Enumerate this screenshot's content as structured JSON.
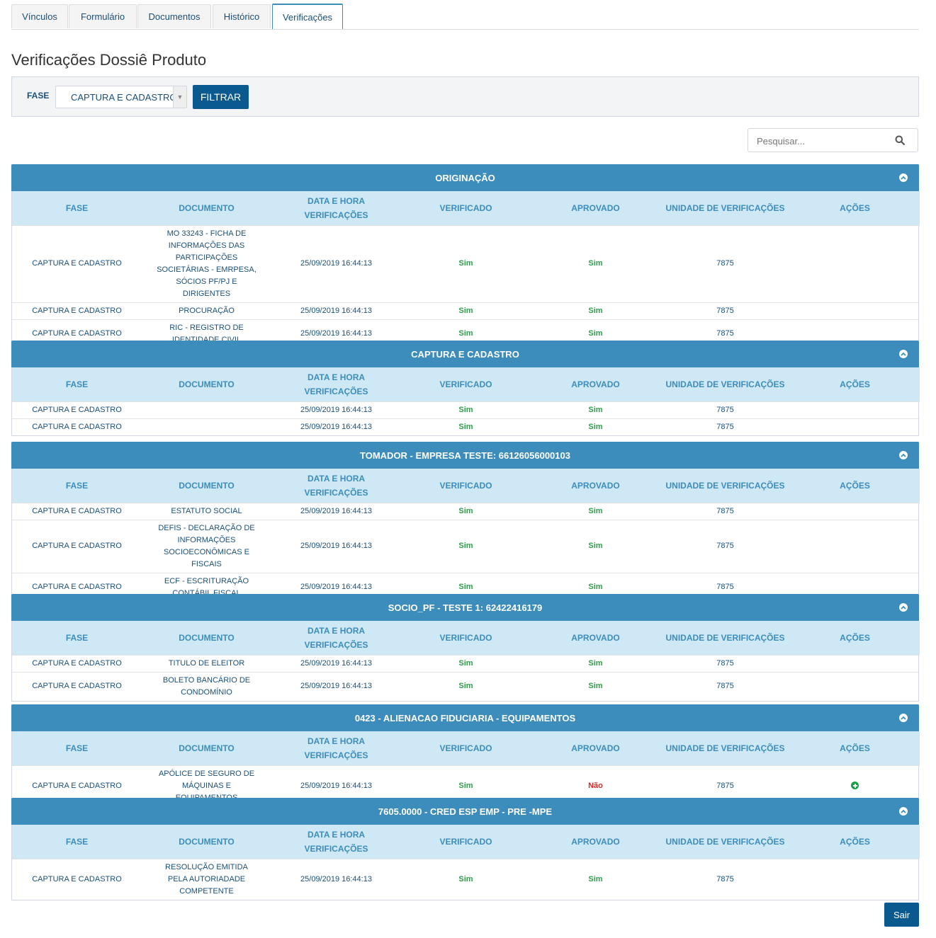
{
  "tabs": [
    {
      "label": "Vínculos"
    },
    {
      "label": "Formulário"
    },
    {
      "label": "Documentos"
    },
    {
      "label": "Histórico"
    },
    {
      "label": "Verificações",
      "active": true
    }
  ],
  "page_title": "Verificações Dossiê Produto",
  "filter": {
    "label": "FASE",
    "selected": "CAPTURA E CADASTRO",
    "button_label": "FILTRAR"
  },
  "search": {
    "placeholder": "Pesquisar..."
  },
  "columns": {
    "fase": "FASE",
    "documento": "DOCUMENTO",
    "data_line1": "DATA E HORA",
    "data_line2": "VERIFICAÇÕES",
    "verificado": "VERIFICADO",
    "aprovado": "APROVADO",
    "unidade": "UNIDADE DE VERIFICAÇÕES",
    "acoes": "AÇÕES"
  },
  "colors": {
    "header_blue": "#3c8dbc",
    "subheader_blue": "#cfe8f5",
    "button_blue": "#0a5a8f",
    "yes_green": "#2e9e4b",
    "no_red": "#dd2222"
  },
  "sections": [
    {
      "title": "ORIGINAÇÃO",
      "rows": [
        {
          "fase": "CAPTURA E CADASTRO",
          "documento": "MO 33243 - FICHA DE INFORMAÇÕES DAS PARTICIPAÇÕES SOCIETÁRIAS - EMRPESA, SÓCIOS PF/PJ E DIRIGENTES",
          "data": "25/09/2019 16:44:13",
          "verificado": "Sim",
          "aprovado": "Sim",
          "unidade": "7875",
          "acao": ""
        },
        {
          "fase": "CAPTURA E CADASTRO",
          "documento": "PROCURAÇÃO",
          "data": "25/09/2019 16:44:13",
          "verificado": "Sim",
          "aprovado": "Sim",
          "unidade": "7875",
          "acao": ""
        },
        {
          "fase": "CAPTURA E CADASTRO",
          "documento": "RIC - REGISTRO DE IDENTIDADE CIVIL",
          "data": "25/09/2019 16:44:13",
          "verificado": "Sim",
          "aprovado": "Sim",
          "unidade": "7875",
          "acao": ""
        }
      ]
    },
    {
      "title": "CAPTURA E CADASTRO",
      "rows": [
        {
          "fase": "CAPTURA E CADASTRO",
          "documento": "",
          "data": "25/09/2019 16:44:13",
          "verificado": "Sim",
          "aprovado": "Sim",
          "unidade": "7875",
          "acao": ""
        },
        {
          "fase": "CAPTURA E CADASTRO",
          "documento": "",
          "data": "25/09/2019 16:44:13",
          "verificado": "Sim",
          "aprovado": "Sim",
          "unidade": "7875",
          "acao": ""
        }
      ]
    },
    {
      "title": "TOMADOR - EMPRESA TESTE: 66126056000103",
      "rows": [
        {
          "fase": "CAPTURA E CADASTRO",
          "documento": "ESTATUTO SOCIAL",
          "data": "25/09/2019 16:44:13",
          "verificado": "Sim",
          "aprovado": "Sim",
          "unidade": "7875",
          "acao": ""
        },
        {
          "fase": "CAPTURA E CADASTRO",
          "documento": "DEFIS - DECLARAÇÃO DE INFORMAÇÕES SOCIOECONÔMICAS E FISCAIS",
          "data": "25/09/2019 16:44:13",
          "verificado": "Sim",
          "aprovado": "Sim",
          "unidade": "7875",
          "acao": ""
        },
        {
          "fase": "CAPTURA E CADASTRO",
          "documento": "ECF - ESCRITURAÇÃO CONTÁBIL FISCAL",
          "data": "25/09/2019 16:44:13",
          "verificado": "Sim",
          "aprovado": "Sim",
          "unidade": "7875",
          "acao": ""
        }
      ]
    },
    {
      "title": "SOCIO_PF - TESTE 1: 62422416179",
      "rows": [
        {
          "fase": "CAPTURA E CADASTRO",
          "documento": "TITULO DE ELEITOR",
          "data": "25/09/2019 16:44:13",
          "verificado": "Sim",
          "aprovado": "Sim",
          "unidade": "7875",
          "acao": ""
        },
        {
          "fase": "CAPTURA E CADASTRO",
          "documento": "BOLETO BANCÁRIO DE CONDOMÍNIO",
          "data": "25/09/2019 16:44:13",
          "verificado": "Sim",
          "aprovado": "Sim",
          "unidade": "7875",
          "acao": ""
        }
      ]
    },
    {
      "title": "0423 - ALIENACAO FIDUCIARIA - EQUIPAMENTOS",
      "rows": [
        {
          "fase": "CAPTURA E CADASTRO",
          "documento": "APÓLICE DE SEGURO DE MÁQUINAS E EQUIPAMENTOS",
          "data": "25/09/2019 16:44:13",
          "verificado": "Sim",
          "aprovado": "Não",
          "unidade": "7875",
          "acao": "add-circle-icon"
        }
      ]
    },
    {
      "title": "7605.0000 - CRED ESP EMP - PRE -MPE",
      "rows": [
        {
          "fase": "CAPTURA E CADASTRO",
          "documento": "RESOLUÇÃO EMITIDA PELA AUTORIADADE COMPETENTE",
          "data": "25/09/2019 16:44:13",
          "verificado": "Sim",
          "aprovado": "Sim",
          "unidade": "7875",
          "acao": ""
        }
      ]
    }
  ],
  "exit_button_label": "Sair"
}
